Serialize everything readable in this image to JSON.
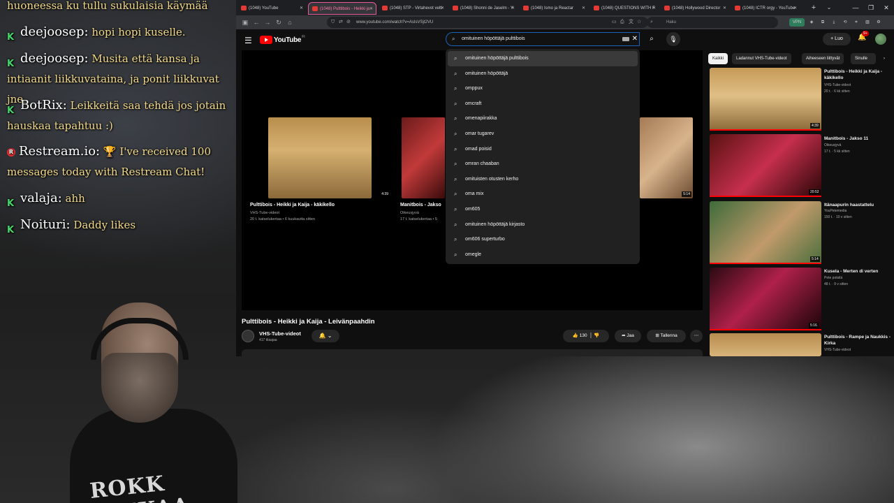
{
  "chat": {
    "lines": [
      {
        "user": "",
        "msg": "huoneessa ku tullu sukulaisia käymää"
      },
      {
        "user": "deejoosep:",
        "msg": "hopi hopi kuselle."
      },
      {
        "user": "deejoosep:",
        "msg": "Musita että kansa ja intiaanit liikkuvataina, ja ponit liikkuvat jne."
      },
      {
        "user": "BotRix:",
        "msg": "Leikkeitä saa tehdä jos jotain hauskaa tapahtuu :)"
      },
      {
        "user": "Restream.io:",
        "msg": "🏆 I've received 100 messages today with Restream Chat!"
      },
      {
        "user": "valaja:",
        "msg": "ahh"
      },
      {
        "user": "Noituri:",
        "msg": "Daddy likes"
      }
    ],
    "badge_k": "K",
    "badge_r": "R"
  },
  "webcam": {
    "shirt_print": "ROKK RAIKAA"
  },
  "browser": {
    "tabs": [
      {
        "label": "(1048) YouTube"
      },
      {
        "label": "(1048) Pulttibois - Heikki ja"
      },
      {
        "label": "(1048) STP - Virtahevot velti"
      },
      {
        "label": "(1048) Shonni de Jaselm - Y"
      },
      {
        "label": "(1048) Ismo ja Reactar"
      },
      {
        "label": "(1048) QUESTIONS WITH F"
      },
      {
        "label": "(1048) Hollywood Director"
      },
      {
        "label": "(1048) ICTR orgy - YouTube"
      }
    ],
    "new_tab": "+",
    "tab_menu": "⌄",
    "url": "www.youtube.com/watch?v=AsIsVSjt2VU",
    "side_search_placeholder": "Haku",
    "vpn": "VPN",
    "minimize": "—",
    "maximize": "❐",
    "close": "✕"
  },
  "youtube": {
    "logo_text": "YouTube",
    "logo_region": "FI",
    "search_value": "omituinen höpöttäjä pulttibois",
    "create_label": "Luo",
    "notif_count": "9+",
    "suggestions": [
      "omituinen höpöttäjä pulttibois",
      "omituinen höpöttäjä",
      "omppux",
      "omcraft",
      "omenapiirakka",
      "omar tugarev",
      "omad poisid",
      "omran chaaban",
      "omituisten otusten kerho",
      "oma mix",
      "om605",
      "omituinen höpöttäjä kirjasto",
      "om606 superturbo",
      "omegle"
    ],
    "endcards": [
      {
        "title": "Pulttibois - Heikki ja Kaija - käkikello",
        "channel": "VHS-Tube-videot",
        "meta": "20 t. katselukertaa • 6 kuukautta sitten",
        "duration": "4:39"
      },
      {
        "title": "Manitbois - Jakso",
        "channel": "Oikeusjyvä",
        "meta": "17 t. katselukertaa • 5",
        "duration": ""
      },
      {
        "title": "",
        "channel": "",
        "meta": "",
        "duration": "5:14"
      }
    ],
    "video_title": "Pulttibois - Heikki ja Kaija - Leivänpaahdin",
    "channel_name": "VHS-Tube-videot",
    "channel_subs": "417 tilaajaa",
    "likes": "130",
    "share_label": "Jaa",
    "save_label": "Tallenna",
    "chips": [
      "Kaikki",
      "Ladannut VHS-Tube-videot",
      "Aiheeseen liittyvät",
      "Sinulle"
    ],
    "recommendations": [
      {
        "title": "Pulttibois - Heikki ja Kaija - käkikello",
        "channel": "VHS-Tube-videot",
        "meta": "20 t. · 6 kk sitten",
        "duration": "4:39"
      },
      {
        "title": "Manitbois - Jakso 11",
        "channel": "Oikeusjyvä",
        "meta": "17 t. · 5 kk sitten",
        "duration": "20:52"
      },
      {
        "title": "Itänaapurin haastattelu",
        "channel": "YouPetemedia",
        "meta": "150 t. · 10 v sitten",
        "duration": "5:14"
      },
      {
        "title": "Kusela - Merten di verten",
        "channel": "Pete potsilä",
        "meta": "48 t. · 9 v sitten",
        "duration": "5:16"
      },
      {
        "title": "Pulttibois - Rampe ja Naukkis - Kirka",
        "channel": "VHS-Tube-videot",
        "meta": "",
        "duration": ""
      }
    ]
  }
}
